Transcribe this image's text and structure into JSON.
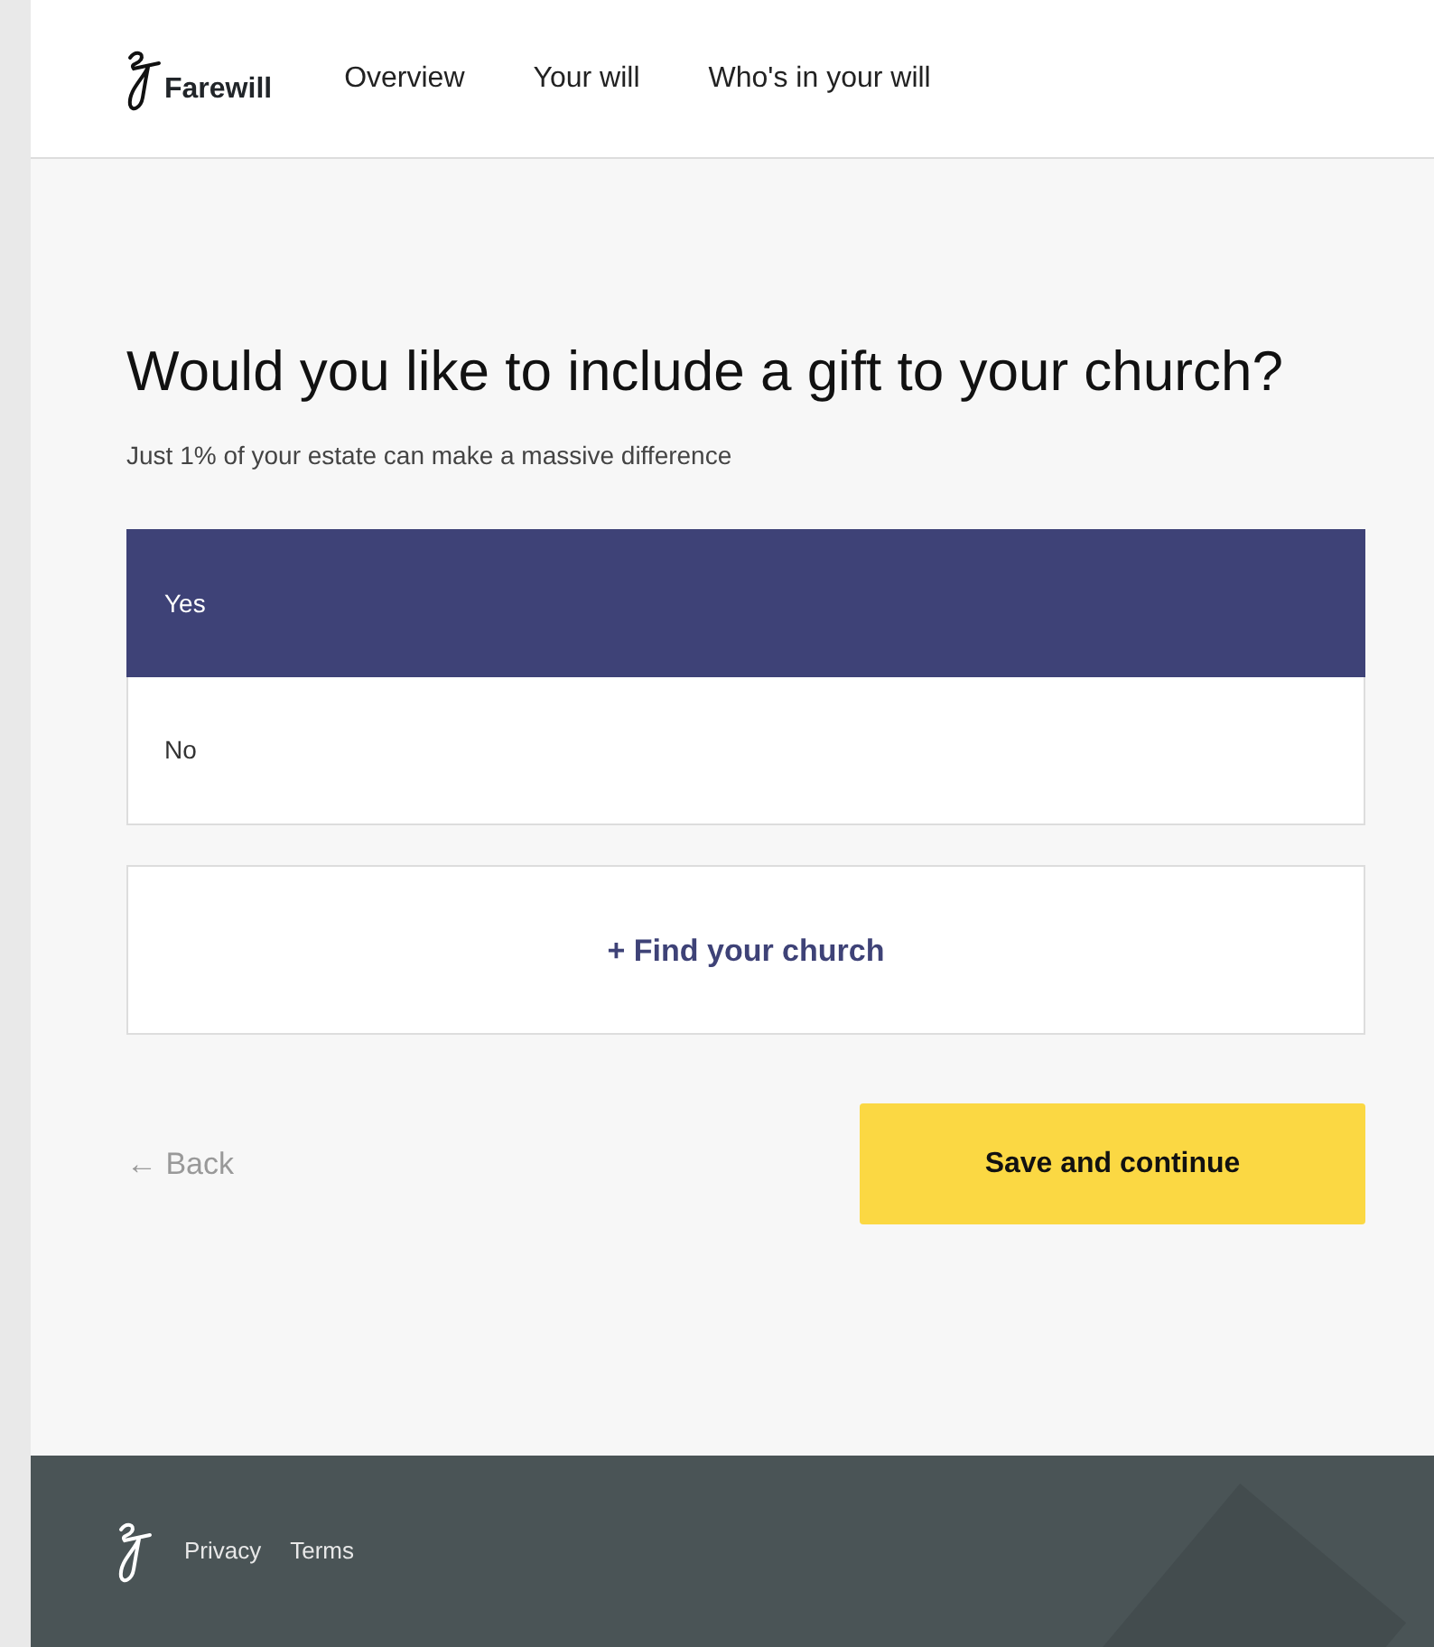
{
  "header": {
    "brand": "Farewill",
    "nav": [
      {
        "label": "Overview"
      },
      {
        "label": "Your will"
      },
      {
        "label": "Who's in your will"
      }
    ]
  },
  "question": {
    "title": "Would you like to include a gift to your church?",
    "subtitle": "Just 1% of your estate can make a massive difference"
  },
  "options": [
    {
      "label": "Yes",
      "selected": true
    },
    {
      "label": "No",
      "selected": false
    }
  ],
  "find_button": "+ Find your church",
  "back_link": "← Back",
  "submit_button": "Save and continue",
  "footer": {
    "links": [
      "Privacy",
      "Terms"
    ]
  }
}
